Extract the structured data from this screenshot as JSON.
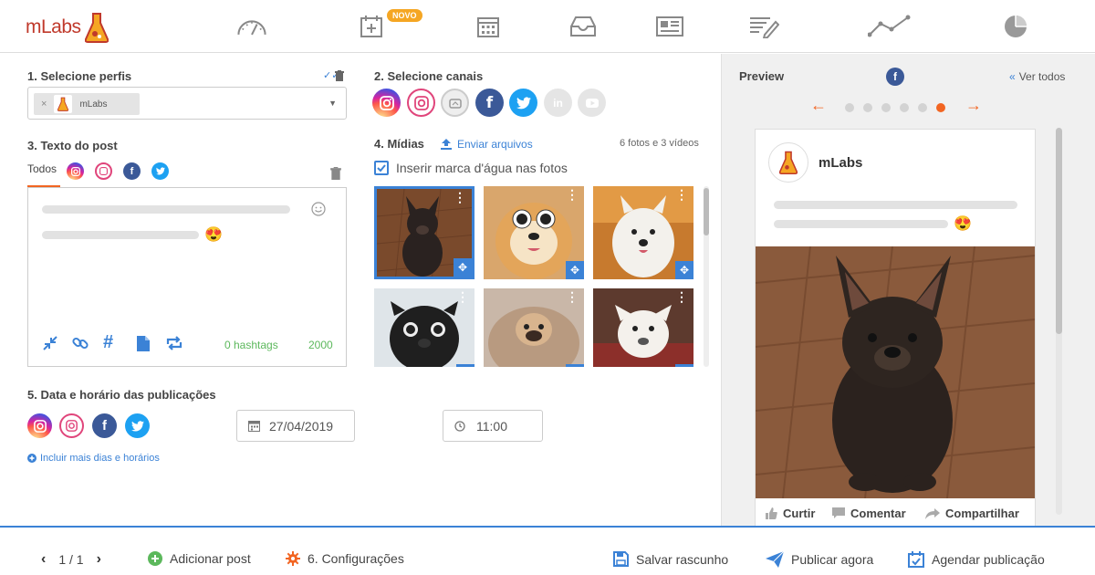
{
  "app": {
    "brand": "mLabs",
    "nav": [
      "dashboard-icon",
      "new-post-icon",
      "calendar-icon",
      "inbox-icon",
      "news-icon",
      "report-edit-icon",
      "analytics-line-icon",
      "pie-chart-icon"
    ],
    "novo_badge": "NOVO"
  },
  "profiles": {
    "title": "1. Selecione perfis",
    "selected_chip": "mLabs"
  },
  "channels": {
    "title": "2. Selecione canais"
  },
  "post_text": {
    "title": "3. Texto do post",
    "tab_all": "Todos",
    "hashtags_label": "0 hashtags",
    "char_count": "2000"
  },
  "media": {
    "title": "4. Mídias",
    "upload_label": "Enviar arquivos",
    "count_label": "6 fotos e 3 vídeos",
    "watermark_label": "Inserir marca d'água nas fotos",
    "watermark_checked": true
  },
  "schedule": {
    "title": "5. Data e horário das publicações",
    "date": "27/04/2019",
    "time": "11:00",
    "add_more": "Incluir mais dias e horários"
  },
  "preview": {
    "title": "Preview",
    "see_all": "Ver todos",
    "profile_name": "mLabs",
    "like": "Curtir",
    "comment": "Comentar",
    "share": "Compartilhar",
    "dots_total": 6,
    "dots_active": 6
  },
  "footer": {
    "pagination": "1 / 1",
    "add_post": "Adicionar post",
    "settings": "6. Configurações",
    "save_draft": "Salvar rascunho",
    "publish_now": "Publicar agora",
    "schedule_post": "Agendar publicação"
  },
  "colors": {
    "accent_blue": "#3b82d6",
    "accent_orange": "#f26522",
    "facebook": "#3b5998",
    "twitter": "#1da1f2",
    "green": "#5cb85c"
  }
}
